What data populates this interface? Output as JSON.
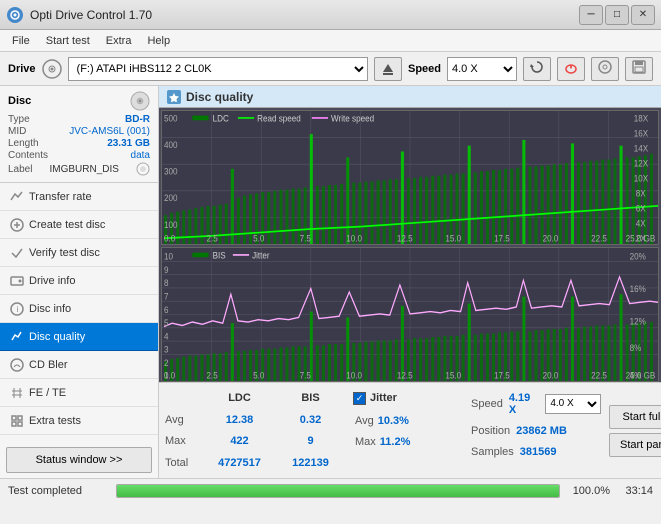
{
  "titlebar": {
    "title": "Opti Drive Control 1.70",
    "icon": "ODC",
    "minimize": "─",
    "maximize": "□",
    "close": "✕"
  },
  "menubar": {
    "items": [
      "File",
      "Start test",
      "Extra",
      "Help"
    ]
  },
  "drivebar": {
    "drive_label": "Drive",
    "drive_value": "(F:)  ATAPI iHBS112  2 CL0K",
    "speed_label": "Speed",
    "speed_value": "4.0 X"
  },
  "disc": {
    "title": "Disc",
    "type_label": "Type",
    "type_value": "BD-R",
    "mid_label": "MID",
    "mid_value": "JVC-AMS6L (001)",
    "length_label": "Length",
    "length_value": "23.31 GB",
    "contents_label": "Contents",
    "contents_value": "data",
    "label_label": "Label",
    "label_value": "IMGBURN_DIS"
  },
  "nav": {
    "items": [
      {
        "id": "transfer-rate",
        "label": "Transfer rate"
      },
      {
        "id": "create-test-disc",
        "label": "Create test disc"
      },
      {
        "id": "verify-test-disc",
        "label": "Verify test disc"
      },
      {
        "id": "drive-info",
        "label": "Drive info"
      },
      {
        "id": "disc-info",
        "label": "Disc info"
      },
      {
        "id": "disc-quality",
        "label": "Disc quality",
        "active": true
      },
      {
        "id": "cd-bler",
        "label": "CD Bler"
      },
      {
        "id": "fe-te",
        "label": "FE / TE"
      },
      {
        "id": "extra-tests",
        "label": "Extra tests"
      }
    ],
    "status_btn": "Status window >>"
  },
  "quality": {
    "title": "Disc quality",
    "icon": "★",
    "legend": {
      "ldc_label": "LDC",
      "ldc_color": "#00aa00",
      "read_label": "Read speed",
      "read_color": "#00ff00",
      "write_label": "Write speed",
      "write_color": "#ff00ff"
    },
    "legend2": {
      "bis_label": "BIS",
      "bis_color": "#00aa00",
      "jitter_label": "Jitter",
      "jitter_color": "#ff88ff"
    }
  },
  "stats": {
    "columns": [
      "LDC",
      "BIS"
    ],
    "avg_label": "Avg",
    "avg_ldc": "12.38",
    "avg_bis": "0.32",
    "max_label": "Max",
    "max_ldc": "422",
    "max_bis": "9",
    "total_label": "Total",
    "total_ldc": "4727517",
    "total_bis": "122139",
    "jitter_label": "Jitter",
    "jitter_avg": "10.3%",
    "jitter_max": "11.2%",
    "speed_label": "Speed",
    "speed_value": "4.19 X",
    "speed_select": "4.0 X",
    "position_label": "Position",
    "position_value": "23862 MB",
    "samples_label": "Samples",
    "samples_value": "381569",
    "start_full": "Start full",
    "start_part": "Start part"
  },
  "progress": {
    "status": "Test completed",
    "percent": "100.0%",
    "time": "33:14"
  },
  "chart1": {
    "title": "LDC  Read speed  Write speed",
    "y_labels": [
      "500",
      "400",
      "300",
      "200",
      "100",
      "0"
    ],
    "y_right": [
      "18X",
      "16X",
      "14X",
      "12X",
      "10X",
      "8X",
      "6X",
      "4X",
      "2X"
    ],
    "x_labels": [
      "0.0",
      "2.5",
      "5.0",
      "7.5",
      "10.0",
      "12.5",
      "15.0",
      "17.5",
      "20.0",
      "22.5",
      "25.0 GB"
    ]
  },
  "chart2": {
    "title": "BIS  Jitter",
    "y_labels": [
      "10",
      "9",
      "8",
      "7",
      "6",
      "5",
      "4",
      "3",
      "2",
      "1"
    ],
    "y_right": [
      "20%",
      "16%",
      "12%",
      "8%",
      "4%"
    ],
    "x_labels": [
      "0.0",
      "2.5",
      "5.0",
      "7.5",
      "10.0",
      "12.5",
      "15.0",
      "17.5",
      "20.0",
      "22.5",
      "25.0 GB"
    ]
  }
}
